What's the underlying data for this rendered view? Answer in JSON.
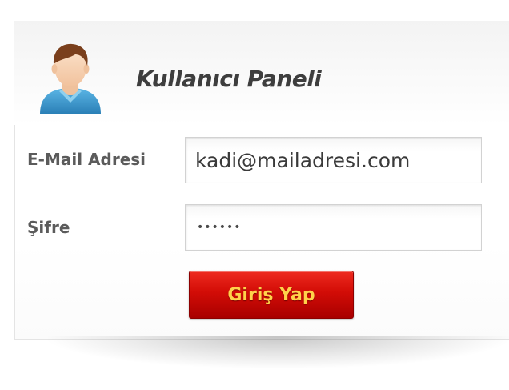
{
  "panel": {
    "title": "Kullanıcı Paneli",
    "avatar_icon": "user-avatar-icon"
  },
  "form": {
    "email_label": "E-Mail Adresi",
    "email_value": "kadi@mailadresi.com",
    "password_label": "Şifre",
    "password_value": "••••••",
    "login_button_label": "Giriş Yap"
  },
  "colors": {
    "button_red": "#d20c06",
    "button_text": "#ffd24a",
    "avatar_shirt": "#3b98cc",
    "avatar_hair": "#7a3f1c",
    "title_text": "#3e3e3e"
  }
}
